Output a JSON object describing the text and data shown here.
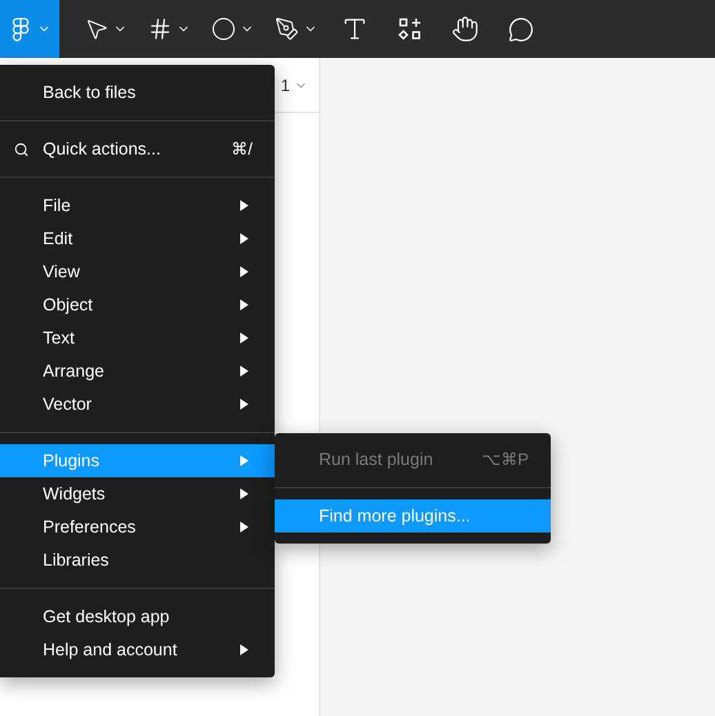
{
  "toolbar": {
    "tools": [
      {
        "kind": "figma",
        "has_dropdown": true,
        "selected": true
      },
      {
        "kind": "move",
        "has_dropdown": true,
        "selected": false
      },
      {
        "kind": "frame",
        "has_dropdown": true,
        "selected": false
      },
      {
        "kind": "ellipse",
        "has_dropdown": true,
        "selected": false
      },
      {
        "kind": "pen",
        "has_dropdown": true,
        "selected": false
      },
      {
        "kind": "text",
        "has_dropdown": false,
        "selected": false
      },
      {
        "kind": "resources",
        "has_dropdown": false,
        "selected": false
      },
      {
        "kind": "hand",
        "has_dropdown": false,
        "selected": false
      },
      {
        "kind": "comment",
        "has_dropdown": false,
        "selected": false
      }
    ]
  },
  "left_panel": {
    "page_label": "1"
  },
  "main_menu": {
    "sections": [
      [
        {
          "label": "Back to files",
          "has_submenu": false,
          "selected": false
        }
      ],
      [
        {
          "kind": "search",
          "label": "Quick actions...",
          "shortcut": "⌘/",
          "has_submenu": false,
          "selected": false
        }
      ],
      [
        {
          "label": "File",
          "has_submenu": true,
          "selected": false
        },
        {
          "label": "Edit",
          "has_submenu": true,
          "selected": false
        },
        {
          "label": "View",
          "has_submenu": true,
          "selected": false
        },
        {
          "label": "Object",
          "has_submenu": true,
          "selected": false
        },
        {
          "label": "Text",
          "has_submenu": true,
          "selected": false
        },
        {
          "label": "Arrange",
          "has_submenu": true,
          "selected": false
        },
        {
          "label": "Vector",
          "has_submenu": true,
          "selected": false
        }
      ],
      [
        {
          "label": "Plugins",
          "has_submenu": true,
          "selected": true
        },
        {
          "label": "Widgets",
          "has_submenu": true,
          "selected": false
        },
        {
          "label": "Preferences",
          "has_submenu": true,
          "selected": false
        },
        {
          "label": "Libraries",
          "has_submenu": false,
          "selected": false
        }
      ],
      [
        {
          "label": "Get desktop app",
          "has_submenu": false,
          "selected": false
        },
        {
          "label": "Help and account",
          "has_submenu": true,
          "selected": false
        }
      ]
    ]
  },
  "submenu": {
    "sections": [
      [
        {
          "label": "Run last plugin",
          "shortcut": "⌥⌘P",
          "disabled": true,
          "selected": false
        }
      ],
      [
        {
          "label": "Find more plugins...",
          "disabled": false,
          "selected": true
        }
      ]
    ]
  }
}
